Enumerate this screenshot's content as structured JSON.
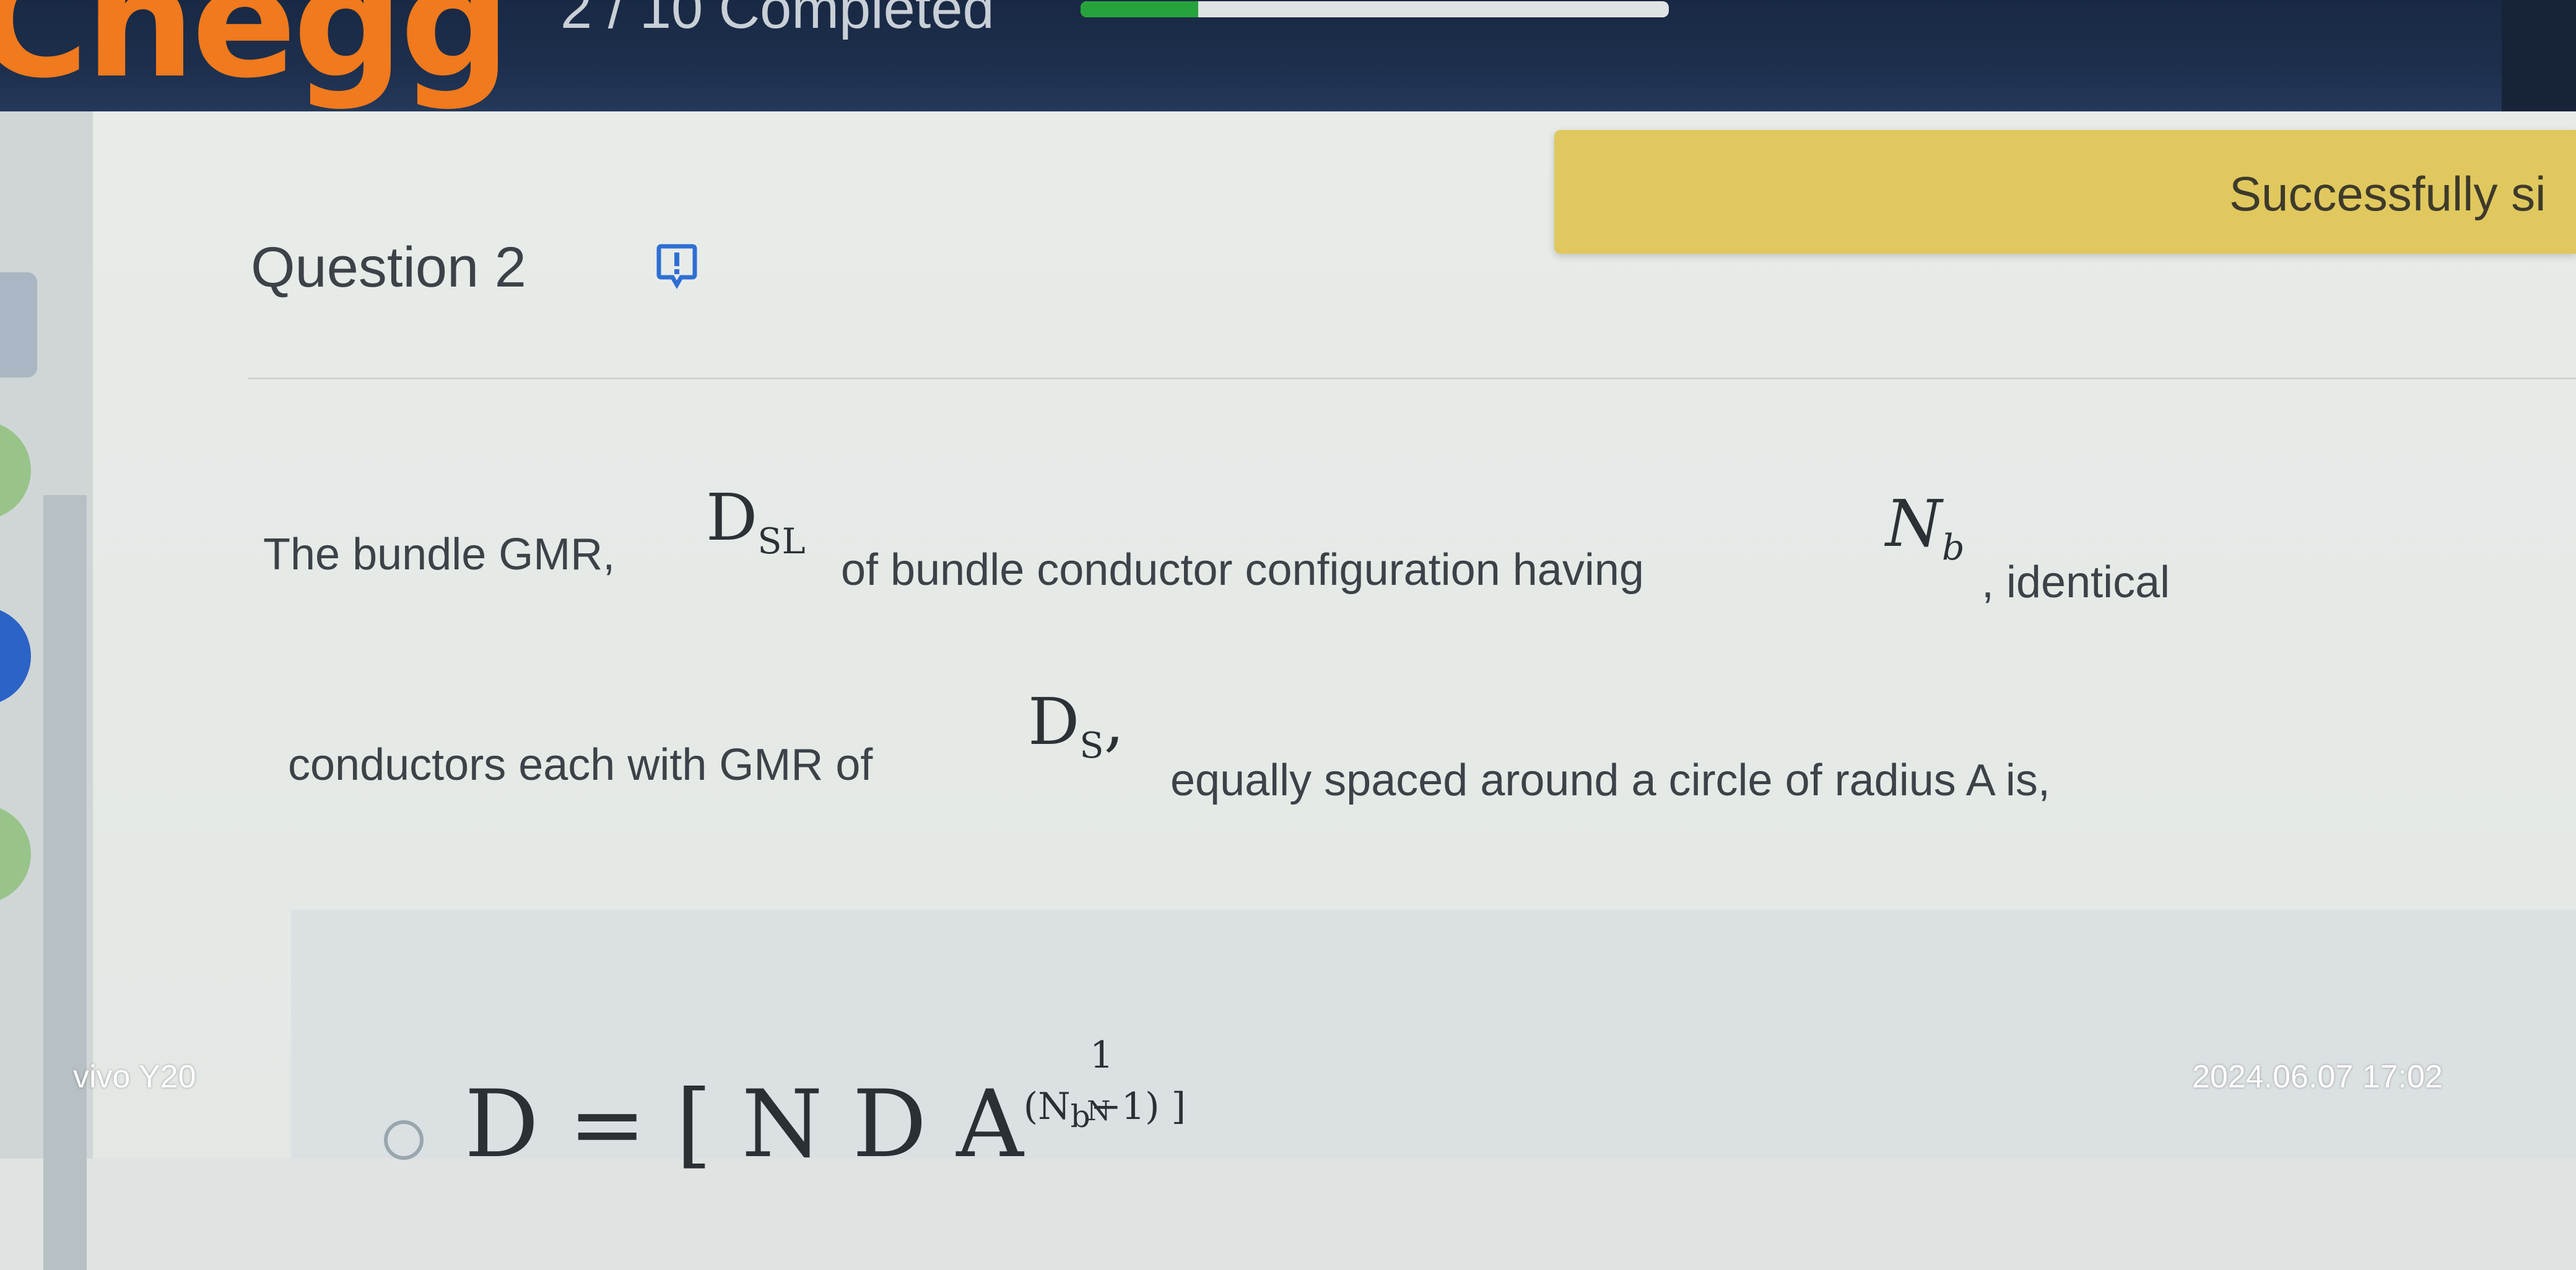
{
  "header": {
    "logo": "Chegg",
    "progress_text": "2 / 10 Completed",
    "progress_fraction": 0.2
  },
  "toast": {
    "text": "Successfully si"
  },
  "question": {
    "title": "Question  2",
    "line1": {
      "part1": "The bundle GMR,",
      "sym1": "D",
      "sym1_sub": "SL",
      "part2": "of bundle conductor configuration having",
      "sym2": "N",
      "sym2_sub": "b",
      "part3": ", identical"
    },
    "line2": {
      "part1": "conductors each with GMR of",
      "sym1": "D",
      "sym1_sub": "S",
      "sym1_trail": ",",
      "part2": "equally spaced around a circle of radius A is,"
    }
  },
  "option1": {
    "formula_main": "D   = [ N D  A",
    "formula_exp": "(N",
    "formula_exp_sub": "b",
    "formula_exp_tail": "−1) ]",
    "formula_frac_top": "1",
    "formula_frac_bottom": "N"
  },
  "watermark": {
    "device": "vivo Y20",
    "timestamp": "2024.06.07 17:02"
  },
  "colors": {
    "header_bg": "#1d2f4d",
    "logo": "#f07a1d",
    "progress_fill": "#27a33c",
    "toast_bg": "#e0c85f",
    "flag_icon": "#2e6fd4"
  },
  "icons": {
    "flag": "flag-icon"
  }
}
